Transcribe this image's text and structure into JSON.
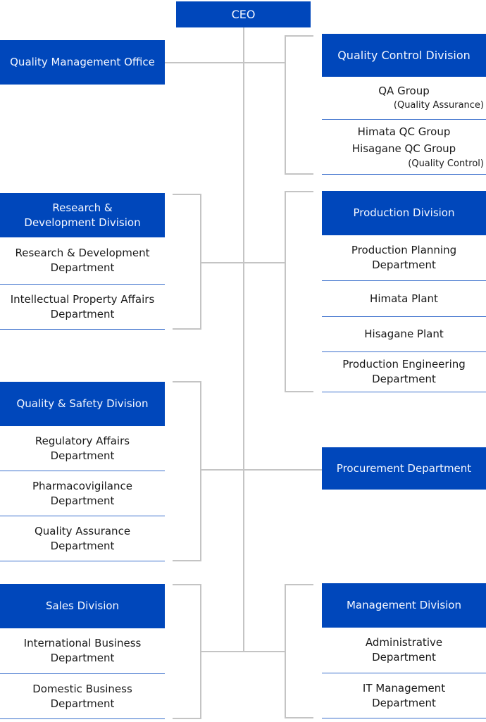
{
  "ceo": {
    "label": "CEO"
  },
  "quality_management_office": {
    "label": "Quality Management Office"
  },
  "quality_control_division": {
    "label": "Quality Control Division",
    "units": [
      {
        "label": "QA Group",
        "note": "(Quality Assurance)"
      },
      {
        "label": "Himata QC Group\nHisagane QC Group",
        "note": "(Quality Control)"
      }
    ]
  },
  "rd_division": {
    "label": "Research &\nDevelopment Division",
    "units": [
      {
        "label": "Research & Development\nDepartment"
      },
      {
        "label": "Intellectual Property Affairs\nDepartment"
      }
    ]
  },
  "production_division": {
    "label": "Production Division",
    "units": [
      {
        "label": "Production Planning\nDepartment"
      },
      {
        "label": "Himata Plant"
      },
      {
        "label": "Hisagane Plant"
      },
      {
        "label": "Production Engineering\nDepartment"
      }
    ]
  },
  "quality_safety_division": {
    "label": "Quality & Safety Division",
    "units": [
      {
        "label": "Regulatory Affairs\nDepartment"
      },
      {
        "label": "Pharmacovigilance\nDepartment"
      },
      {
        "label": "Quality Assurance\nDepartment"
      }
    ]
  },
  "procurement_department": {
    "label": "Procurement Department"
  },
  "sales_division": {
    "label": "Sales Division",
    "units": [
      {
        "label": "International Business\nDepartment"
      },
      {
        "label": "Domestic Business\nDepartment"
      }
    ]
  },
  "management_division": {
    "label": "Management Division",
    "units": [
      {
        "label": "Administrative\nDepartment"
      },
      {
        "label": "IT Management\nDepartment"
      }
    ]
  },
  "colors": {
    "header_blue": "#0047bb",
    "connector_gray": "#c4c4c4",
    "divider_blue": "#3a6fcc"
  }
}
